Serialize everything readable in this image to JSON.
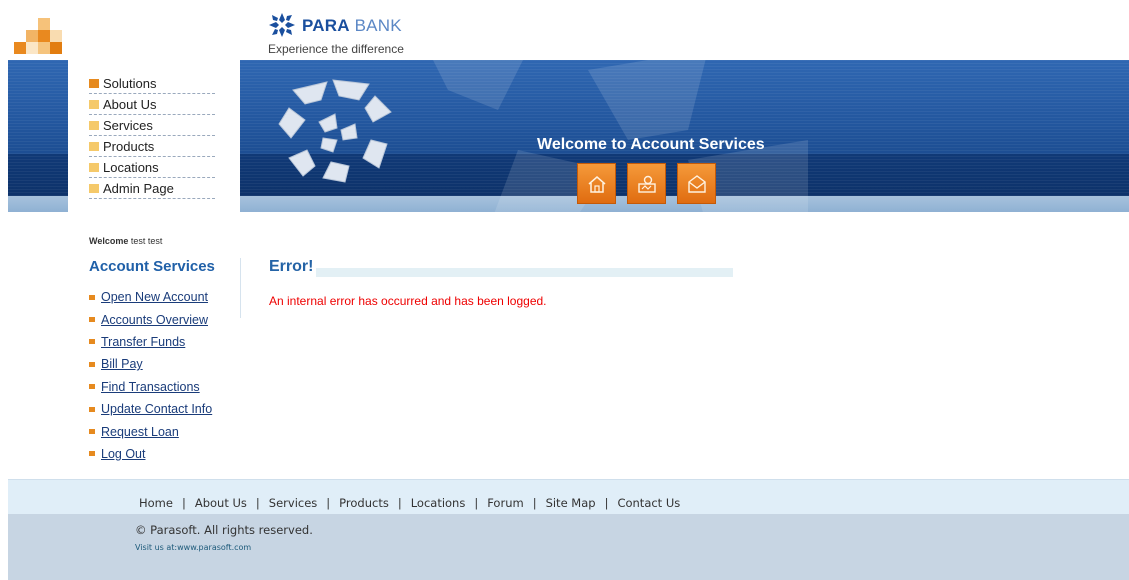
{
  "brand": {
    "name_bold": "PARA",
    "name_light": " BANK",
    "tagline": "Experience the difference"
  },
  "colors": {
    "accent_orange": "#e68a1f",
    "banner_blue": "#23579f",
    "heading_blue": "#2060a8",
    "error_red": "#ee0000"
  },
  "banner": {
    "title": "Welcome to Account Services",
    "buttons": [
      "home-icon",
      "contact-icon",
      "mail-icon"
    ]
  },
  "topnav": {
    "items": [
      {
        "label": "Solutions",
        "color": "#e68a1f"
      },
      {
        "label": "About Us",
        "color": "#f5c96a"
      },
      {
        "label": "Services",
        "color": "#f5c96a"
      },
      {
        "label": "Products",
        "color": "#f5c96a"
      },
      {
        "label": "Locations",
        "color": "#f5c96a"
      },
      {
        "label": "Admin Page",
        "color": "#f5c96a"
      }
    ]
  },
  "user": {
    "welcome_label": "Welcome",
    "name": "test test"
  },
  "account_services": {
    "heading": "Account Services",
    "links": [
      "Open New Account",
      "Accounts Overview",
      "Transfer Funds",
      "Bill Pay",
      "Find Transactions",
      "Update Contact Info",
      "Request Loan",
      "Log Out"
    ]
  },
  "main": {
    "title": "Error!",
    "message": "An internal error has occurred and has been logged."
  },
  "footer": {
    "links": [
      "Home",
      "About Us",
      "Services",
      "Products",
      "Locations",
      "Forum",
      "Site Map",
      "Contact Us"
    ],
    "separator": "|",
    "copyright": "© Parasoft. All rights reserved.",
    "visit": "Visit us at:www.parasoft.com"
  }
}
